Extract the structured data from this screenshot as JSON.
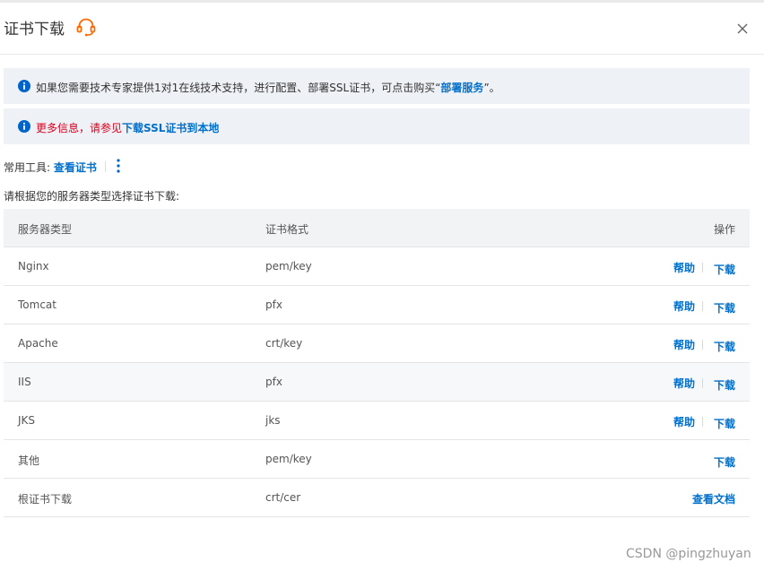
{
  "dialog": {
    "title": "证书下载",
    "close_label": "×"
  },
  "notices": [
    {
      "before": "如果您需要技术专家提供1对1在线技术支持，进行配置、部署SSL证书，可点击购买“",
      "link": "部署服务",
      "after": "”。"
    },
    {
      "before": "更多信息，请参见",
      "link": "下载SSL证书到本地",
      "after": ""
    }
  ],
  "tools": {
    "label": "常用工具:",
    "view_cert": "查看证书"
  },
  "instruction": "请根据您的服务器类型选择证书下载:",
  "table": {
    "headers": [
      "服务器类型",
      "证书格式",
      "操作"
    ],
    "rows": [
      {
        "server": "Nginx",
        "format": "pem/key",
        "help": "帮助",
        "download": "下载"
      },
      {
        "server": "Tomcat",
        "format": "pfx",
        "help": "帮助",
        "download": "下载"
      },
      {
        "server": "Apache",
        "format": "crt/key",
        "help": "帮助",
        "download": "下载"
      },
      {
        "server": "IIS",
        "format": "pfx",
        "help": "帮助",
        "download": "下载"
      },
      {
        "server": "JKS",
        "format": "jks",
        "help": "帮助",
        "download": "下载"
      },
      {
        "server": "其他",
        "format": "pem/key",
        "download": "下载"
      },
      {
        "server": "根证书下载",
        "format": "crt/cer",
        "docs": "查看文档"
      }
    ]
  },
  "watermark": "CSDN @pingzhuyan",
  "colors": {
    "link": "#0070cc",
    "warning": "#d9001b",
    "support_icon": "#ff6a00",
    "notice_bg": "#eef1f6"
  }
}
